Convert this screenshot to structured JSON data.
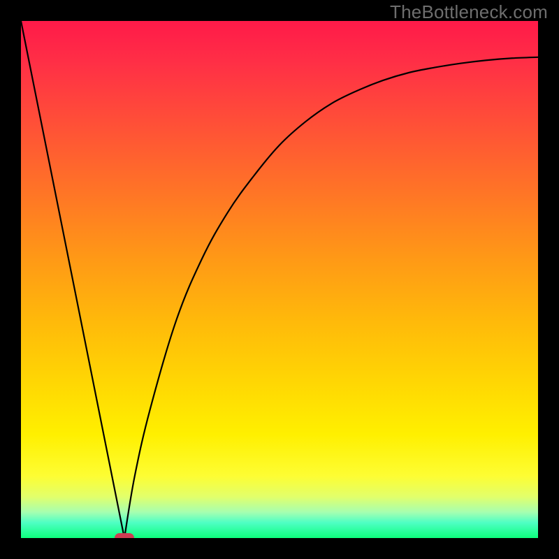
{
  "watermark": "TheBottleneck.com",
  "chart_data": {
    "type": "line",
    "title": "",
    "xlabel": "",
    "ylabel": "",
    "xlim": [
      0,
      100
    ],
    "ylim": [
      0,
      100
    ],
    "grid": false,
    "legend": false,
    "minimum": {
      "x": 20,
      "y": 0
    },
    "annotations": [
      {
        "name": "min-marker",
        "x": 20,
        "y": 0,
        "color": "#ce3c53"
      }
    ],
    "series": [
      {
        "name": "left-branch",
        "segment": "linear",
        "points": [
          {
            "x": 0,
            "y": 100
          },
          {
            "x": 20,
            "y": 0
          }
        ]
      },
      {
        "name": "right-branch",
        "segment": "curve",
        "points": [
          {
            "x": 20,
            "y": 0
          },
          {
            "x": 22,
            "y": 12
          },
          {
            "x": 25,
            "y": 25
          },
          {
            "x": 30,
            "y": 42
          },
          {
            "x": 35,
            "y": 54
          },
          {
            "x": 40,
            "y": 63
          },
          {
            "x": 45,
            "y": 70
          },
          {
            "x": 50,
            "y": 76
          },
          {
            "x": 55,
            "y": 80.5
          },
          {
            "x": 60,
            "y": 84
          },
          {
            "x": 65,
            "y": 86.5
          },
          {
            "x": 70,
            "y": 88.5
          },
          {
            "x": 75,
            "y": 90
          },
          {
            "x": 80,
            "y": 91
          },
          {
            "x": 85,
            "y": 91.8
          },
          {
            "x": 90,
            "y": 92.4
          },
          {
            "x": 95,
            "y": 92.8
          },
          {
            "x": 100,
            "y": 93
          }
        ]
      }
    ],
    "background_gradient": {
      "direction": "top-to-bottom",
      "stops": [
        {
          "pos": 0,
          "color": "#ff1a49"
        },
        {
          "pos": 46,
          "color": "#ff9916"
        },
        {
          "pos": 80,
          "color": "#fff000"
        },
        {
          "pos": 100,
          "color": "#0dff7d"
        }
      ]
    }
  }
}
